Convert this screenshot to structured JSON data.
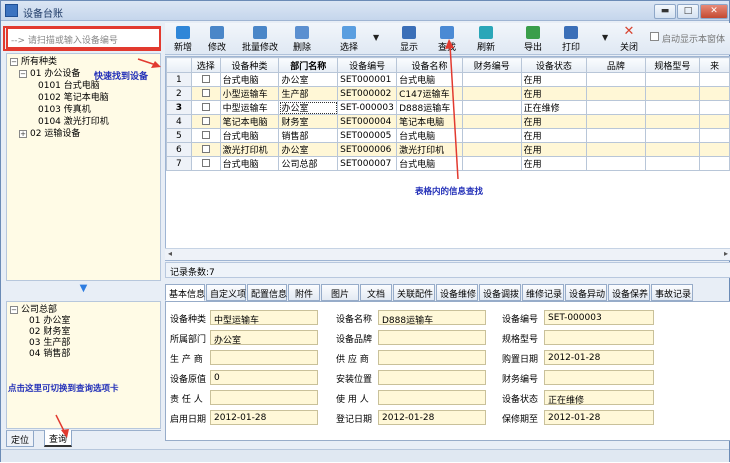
{
  "window": {
    "title": "设备台账",
    "min": "▬",
    "max": "□",
    "close": "✕"
  },
  "search": {
    "placeholder": "--> 请扫描或输入设备编号"
  },
  "tree": {
    "root": "所有种类",
    "items": [
      {
        "label": "01 办公设备"
      },
      {
        "label": "0101 台式电脑"
      },
      {
        "label": "0102 笔记本电脑"
      },
      {
        "label": "0103 传真机"
      },
      {
        "label": "0104 激光打印机"
      },
      {
        "label": "02 运输设备"
      }
    ],
    "annotation": "快速找到设备"
  },
  "dept_tree": {
    "root": "公司总部",
    "items": [
      {
        "label": "01 办公室"
      },
      {
        "label": "02 财务室"
      },
      {
        "label": "03 生产部"
      },
      {
        "label": "04 销售部"
      }
    ]
  },
  "left_annotation": "点击这里可切换到查询选项卡",
  "left_tabs": [
    {
      "label": "定位"
    },
    {
      "label": "查询"
    }
  ],
  "toolbar": {
    "buttons": [
      {
        "label": "新增",
        "icon": "new-icon",
        "color": "#2f86d8"
      },
      {
        "label": "修改",
        "icon": "edit-icon",
        "color": "#4a86c8"
      },
      {
        "label": "批量修改",
        "icon": "batch-edit-icon",
        "color": "#4a86c8"
      },
      {
        "label": "删除",
        "icon": "delete-icon",
        "color": "#5b8fd0"
      },
      {
        "label": "选择",
        "icon": "select-icon",
        "color": "#5a9ee0"
      },
      {
        "label": "显示",
        "icon": "display-icon",
        "color": "#3b6fb8"
      },
      {
        "label": "查找",
        "icon": "find-icon",
        "color": "#4b8ad4"
      },
      {
        "label": "刷新",
        "icon": "refresh-icon",
        "color": "#2aa6b8"
      },
      {
        "label": "导出",
        "icon": "export-icon",
        "color": "#3a9e4a"
      },
      {
        "label": "打印",
        "icon": "print-icon",
        "color": "#3b6fb8"
      },
      {
        "label": "关闭",
        "icon": "close-icon",
        "color": "#d8432f"
      }
    ],
    "startup_label": "启动显示本窗体"
  },
  "grid": {
    "headers": [
      "",
      "选择",
      "设备种类",
      "部门名称",
      "设备编号",
      "设备名称",
      "财务编号",
      "设备状态",
      "品牌",
      "规格型号",
      "来"
    ],
    "rows": [
      [
        "1",
        "",
        "台式电脑",
        "办公室",
        "SET000001",
        "台式电脑",
        "",
        "在用",
        "",
        "",
        ""
      ],
      [
        "2",
        "",
        "小型运输车",
        "生产部",
        "SET000002",
        "C147运输车",
        "",
        "在用",
        "",
        "",
        ""
      ],
      [
        "3",
        "",
        "中型运输车",
        "办公室",
        "SET-000003",
        "D888运输车",
        "",
        "正在维修",
        "",
        "",
        ""
      ],
      [
        "4",
        "",
        "笔记本电脑",
        "财务室",
        "SET000004",
        "笔记本电脑",
        "",
        "在用",
        "",
        "",
        ""
      ],
      [
        "5",
        "",
        "台式电脑",
        "销售部",
        "SET000005",
        "台式电脑",
        "",
        "在用",
        "",
        "",
        ""
      ],
      [
        "6",
        "",
        "激光打印机",
        "办公室",
        "SET000006",
        "激光打印机",
        "",
        "在用",
        "",
        "",
        ""
      ],
      [
        "7",
        "",
        "台式电脑",
        "公司总部",
        "SET000007",
        "台式电脑",
        "",
        "在用",
        "",
        "",
        ""
      ]
    ],
    "annotation": "表格内的信息查找"
  },
  "record_count": "记录条数:7",
  "detail_tabs": [
    {
      "label": "基本信息"
    },
    {
      "label": "自定义项"
    },
    {
      "label": "配置信息"
    },
    {
      "label": "附件"
    },
    {
      "label": "图片"
    },
    {
      "label": "文档"
    },
    {
      "label": "关联配件"
    },
    {
      "label": "设备维修"
    },
    {
      "label": "设备调拨"
    },
    {
      "label": "维修记录"
    },
    {
      "label": "设备异动"
    },
    {
      "label": "设备保养"
    },
    {
      "label": "事故记录"
    }
  ],
  "detail": {
    "labels": {
      "type": "设备种类",
      "name": "设备名称",
      "code": "设备编号",
      "dept": "所属部门",
      "brand": "设备品牌",
      "model": "规格型号",
      "maker": "生 产 商",
      "supplier": "供 应 商",
      "buy_date": "购置日期",
      "value": "设备原值",
      "location": "安装位置",
      "fin_code": "财务编号",
      "owner": "责 任 人",
      "user": "使 用 人",
      "status": "设备状态",
      "start": "启用日期",
      "reg": "登记日期",
      "warranty": "保修期至"
    },
    "values": {
      "type": "中型运输车",
      "name": "D888运输车",
      "code": "SET-000003",
      "dept": "办公室",
      "brand": "",
      "model": "",
      "maker": "",
      "supplier": "",
      "buy_date": "2012-01-28",
      "value": "0",
      "location": "",
      "fin_code": "",
      "owner": "",
      "user": "",
      "status": "正在维修",
      "start": "2012-01-28",
      "reg": "2012-01-28",
      "warranty": "2012-01-28"
    }
  },
  "colors": {
    "annotation": "#2330b8",
    "highlight_box": "#e23a2f",
    "row_alt": "#fff7d6",
    "field_bg": "#fff8d8"
  }
}
